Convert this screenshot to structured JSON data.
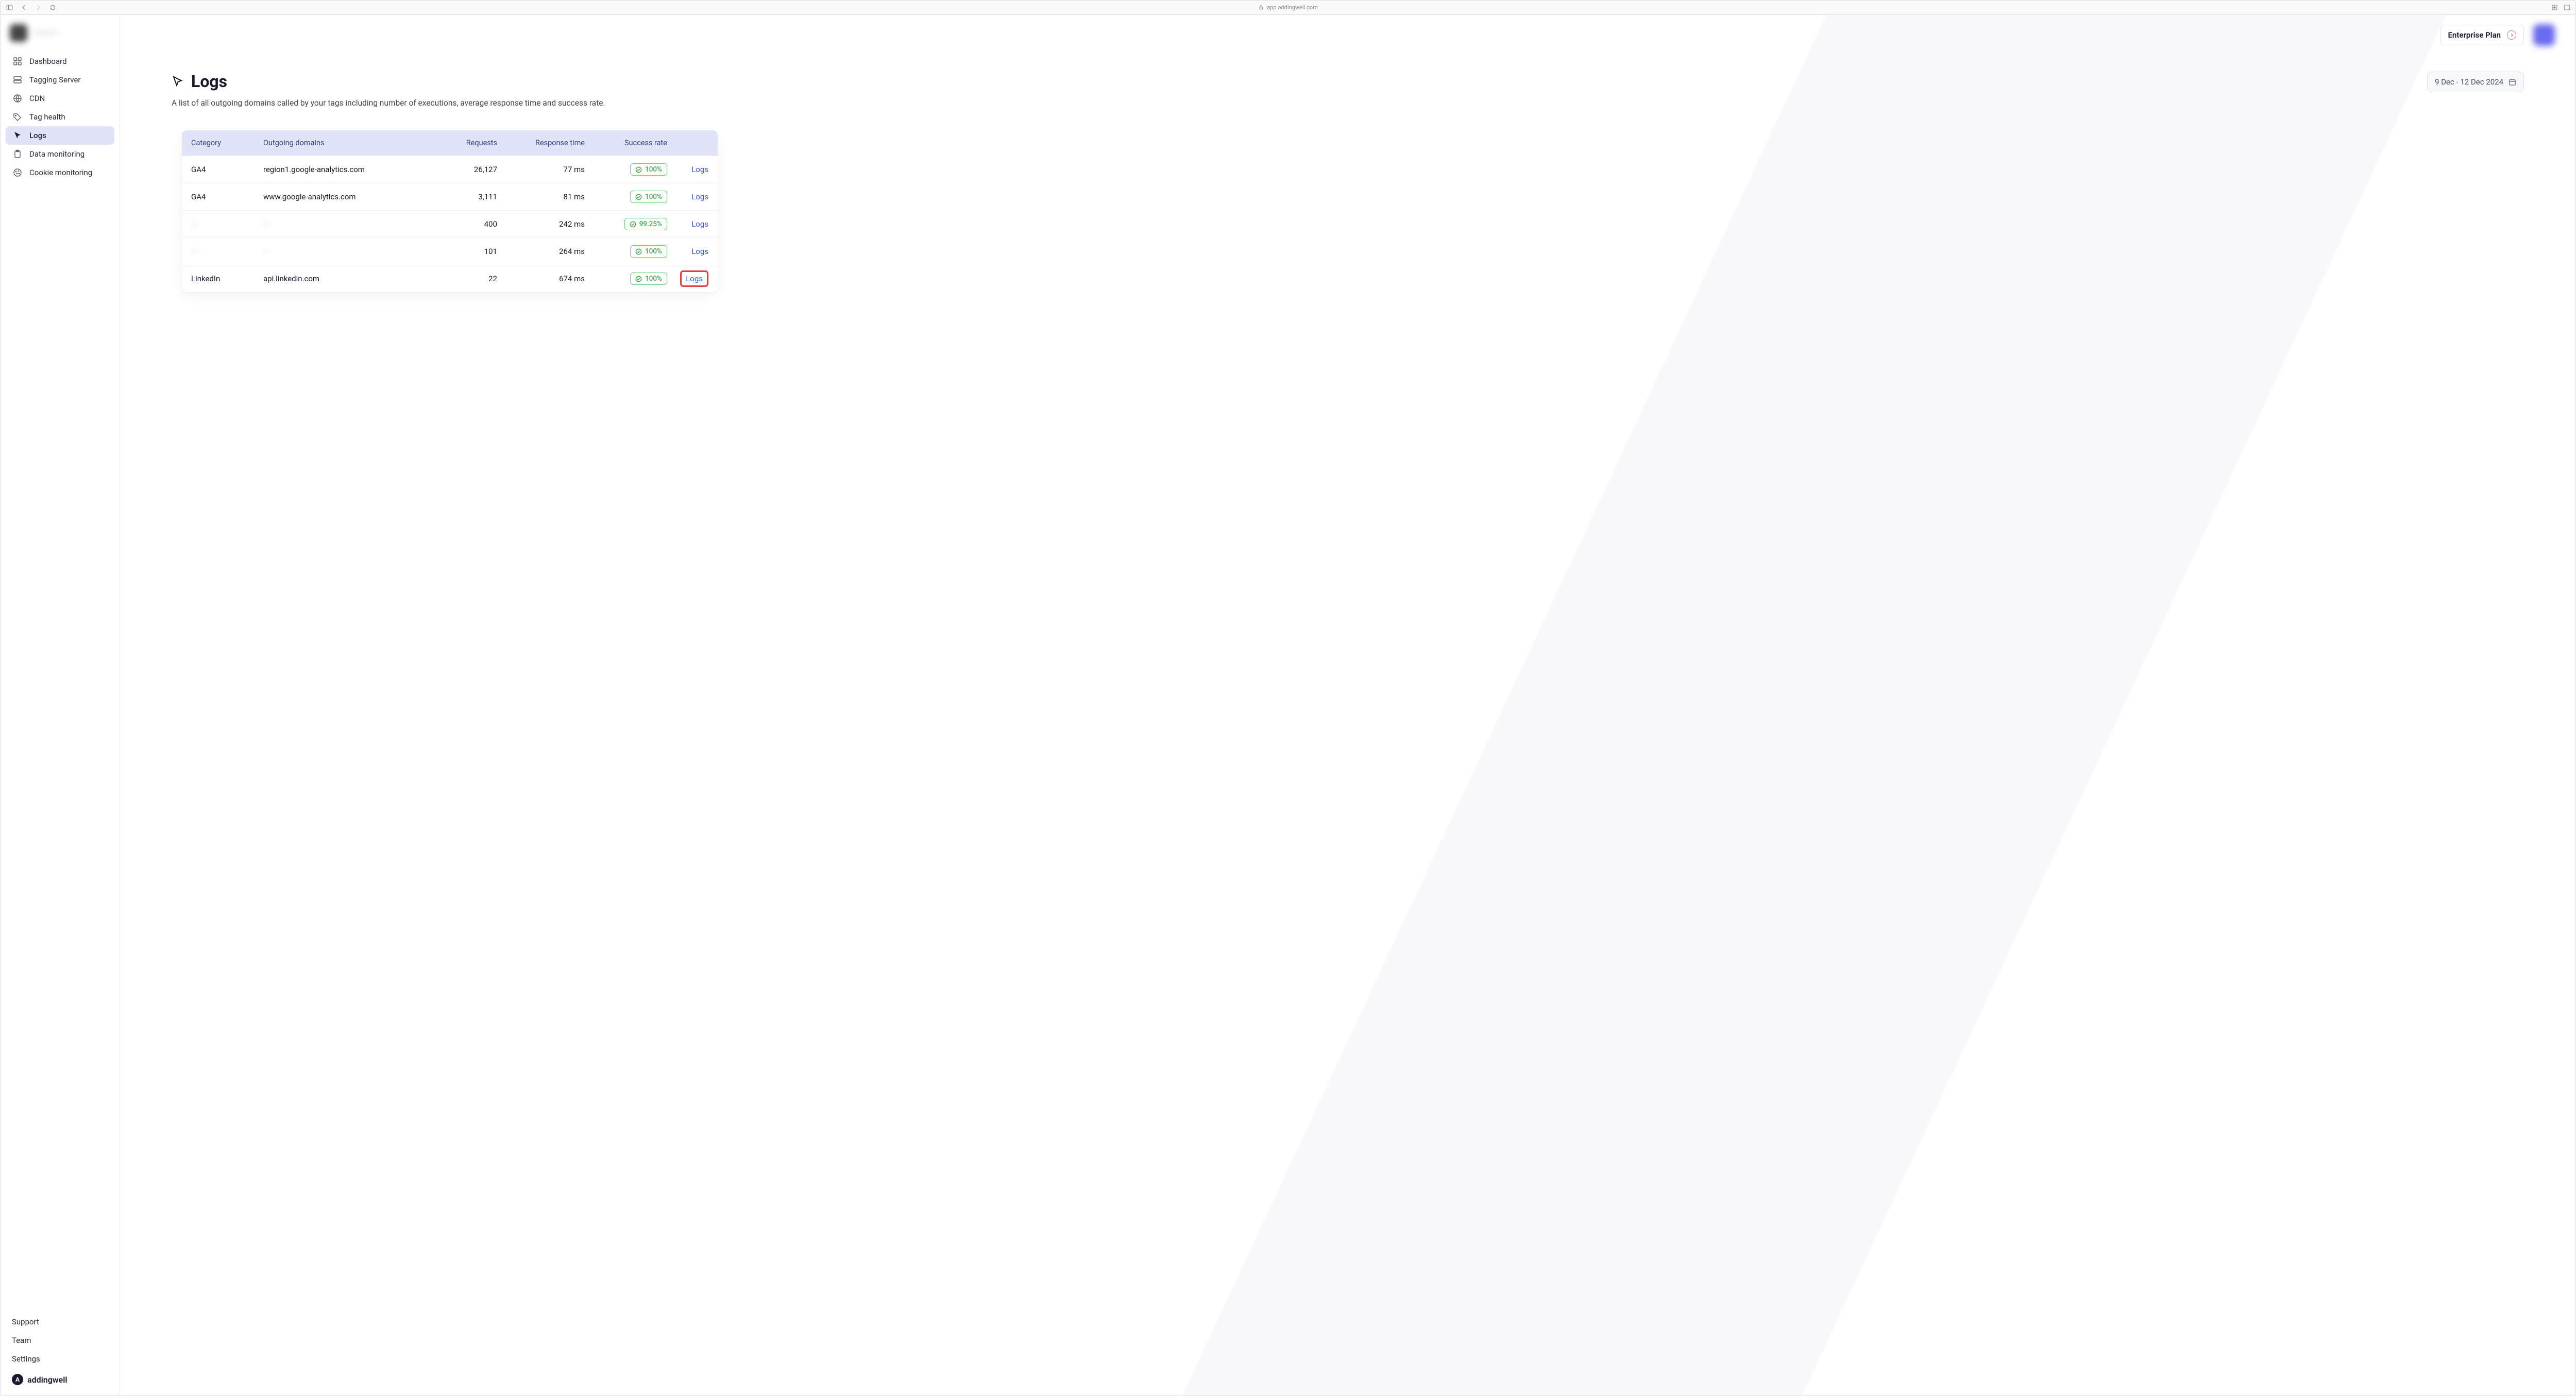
{
  "browser": {
    "url": "app.addingwell.com"
  },
  "sidebar": {
    "items": [
      {
        "label": "Dashboard"
      },
      {
        "label": "Tagging Server"
      },
      {
        "label": "CDN"
      },
      {
        "label": "Tag health"
      },
      {
        "label": "Logs"
      },
      {
        "label": "Data monitoring"
      },
      {
        "label": "Cookie monitoring"
      }
    ],
    "bottom": {
      "support": "Support",
      "team": "Team",
      "settings": "Settings"
    },
    "brand": "addingwell"
  },
  "topbar": {
    "plan_label": "Enterprise Plan"
  },
  "page": {
    "title": "Logs",
    "subtitle": "A list of all outgoing domains called by your tags including number of executions, average response time and success rate.",
    "date_range": "9 Dec - 12 Dec 2024"
  },
  "table": {
    "headers": {
      "category": "Category",
      "domain": "Outgoing domains",
      "requests": "Requests",
      "response": "Response time",
      "success": "Success rate"
    },
    "log_link_label": "Logs",
    "rows": [
      {
        "category": "GA4",
        "domain": "region1.google-analytics.com",
        "requests": "26,127",
        "response": "77 ms",
        "success": "100%",
        "blurred": false,
        "highlighted": false
      },
      {
        "category": "GA4",
        "domain": "www.google-analytics.com",
        "requests": "3,111",
        "response": "81 ms",
        "success": "100%",
        "blurred": false,
        "highlighted": false
      },
      {
        "category": "—",
        "domain": "—",
        "requests": "400",
        "response": "242 ms",
        "success": "99.25%",
        "blurred": true,
        "highlighted": false
      },
      {
        "category": "—",
        "domain": "—",
        "requests": "101",
        "response": "264 ms",
        "success": "100%",
        "blurred": true,
        "highlighted": false
      },
      {
        "category": "LinkedIn",
        "domain": "api.linkedin.com",
        "requests": "22",
        "response": "674 ms",
        "success": "100%",
        "blurred": false,
        "highlighted": true
      }
    ]
  }
}
